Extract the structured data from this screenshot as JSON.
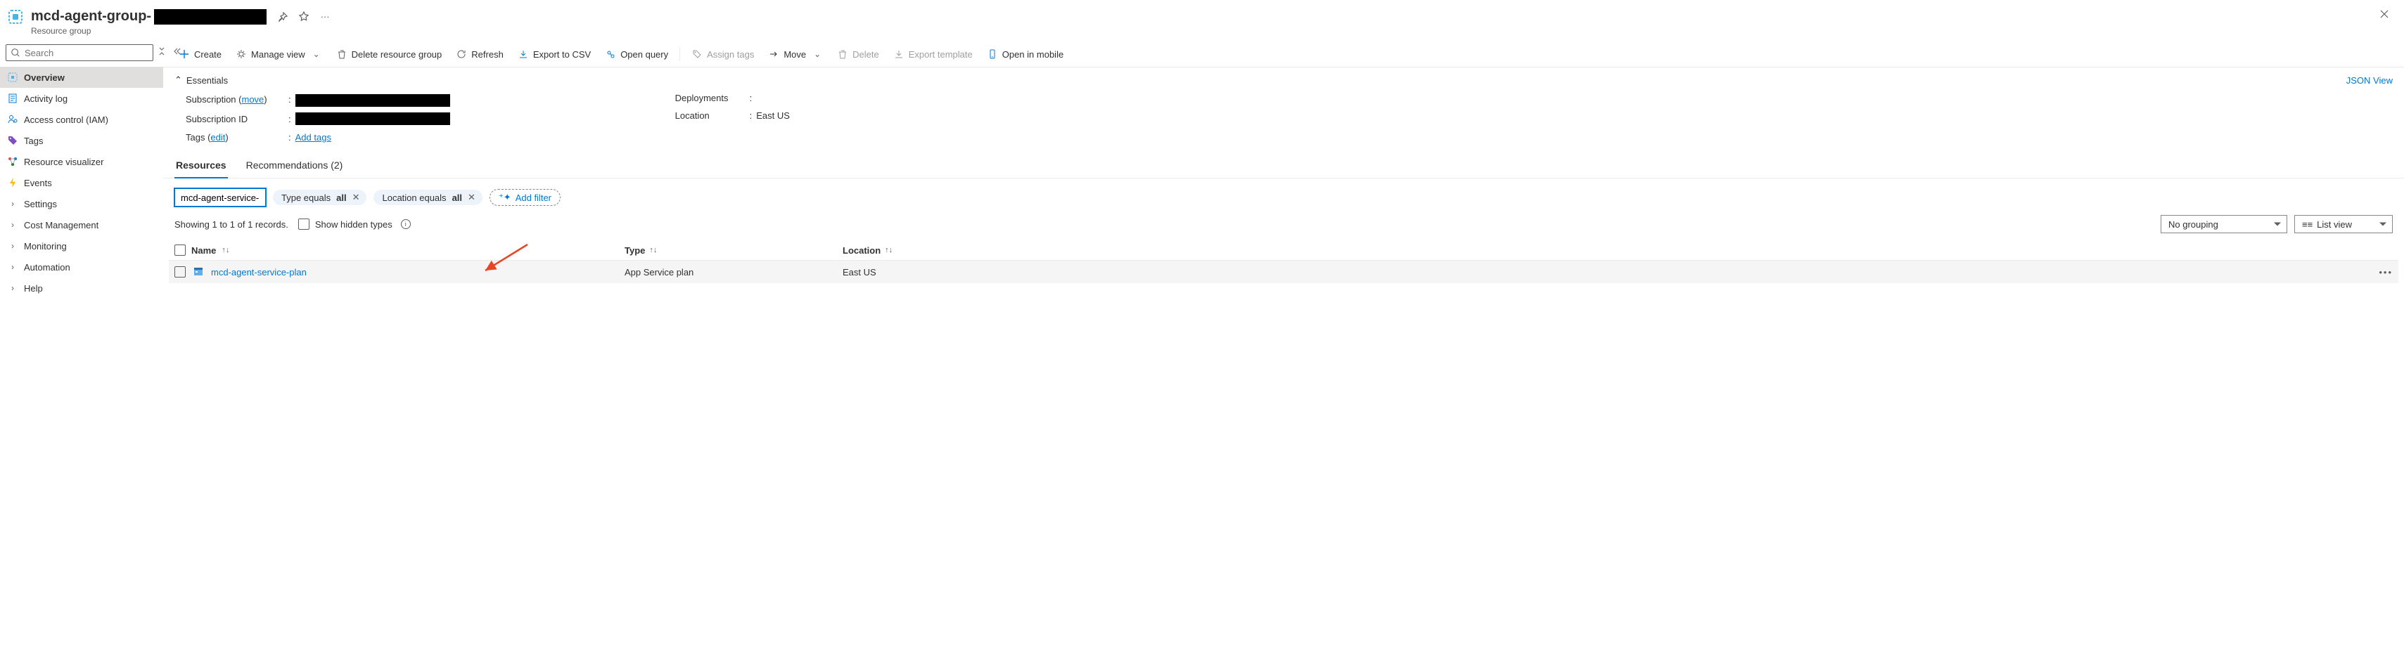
{
  "header": {
    "title_prefix": "mcd-agent-group-",
    "subtitle": "Resource group"
  },
  "sidebar": {
    "search_placeholder": "Search",
    "items": [
      {
        "label": "Overview",
        "icon": "overview",
        "active": true
      },
      {
        "label": "Activity log",
        "icon": "log"
      },
      {
        "label": "Access control (IAM)",
        "icon": "iam"
      },
      {
        "label": "Tags",
        "icon": "tags"
      },
      {
        "label": "Resource visualizer",
        "icon": "visualizer"
      },
      {
        "label": "Events",
        "icon": "events"
      },
      {
        "label": "Settings",
        "icon": "chevron"
      },
      {
        "label": "Cost Management",
        "icon": "chevron"
      },
      {
        "label": "Monitoring",
        "icon": "chevron"
      },
      {
        "label": "Automation",
        "icon": "chevron"
      },
      {
        "label": "Help",
        "icon": "chevron"
      }
    ]
  },
  "toolbar": {
    "create": "Create",
    "manage": "Manage view",
    "delete_rg": "Delete resource group",
    "refresh": "Refresh",
    "export_csv": "Export to CSV",
    "open_query": "Open query",
    "assign_tags": "Assign tags",
    "move": "Move",
    "delete": "Delete",
    "export_tpl": "Export template",
    "open_mobile": "Open in mobile"
  },
  "essentials": {
    "header": "Essentials",
    "json_view": "JSON View",
    "subscription_lbl": "Subscription",
    "subscription_move": "move",
    "subid_lbl": "Subscription ID",
    "tags_lbl": "Tags",
    "tags_edit": "edit",
    "tags_add": "Add tags",
    "deployments_lbl": "Deployments",
    "location_lbl": "Location",
    "location_val": "East US"
  },
  "tabs": {
    "resources": "Resources",
    "recommendations": "Recommendations (2)"
  },
  "filters": {
    "input_value": "mcd-agent-service-pla",
    "type_prefix": "Type equals ",
    "type_val": "all",
    "loc_prefix": "Location equals ",
    "loc_val": "all",
    "add": "Add filter"
  },
  "records": {
    "status": "Showing 1 to 1 of 1 records.",
    "show_hidden": "Show hidden types",
    "grouping": "No grouping",
    "view": "List view"
  },
  "table": {
    "cols": {
      "name": "Name",
      "type": "Type",
      "location": "Location"
    },
    "rows": [
      {
        "name": "mcd-agent-service-plan",
        "type": "App Service plan",
        "location": "East US"
      }
    ]
  }
}
